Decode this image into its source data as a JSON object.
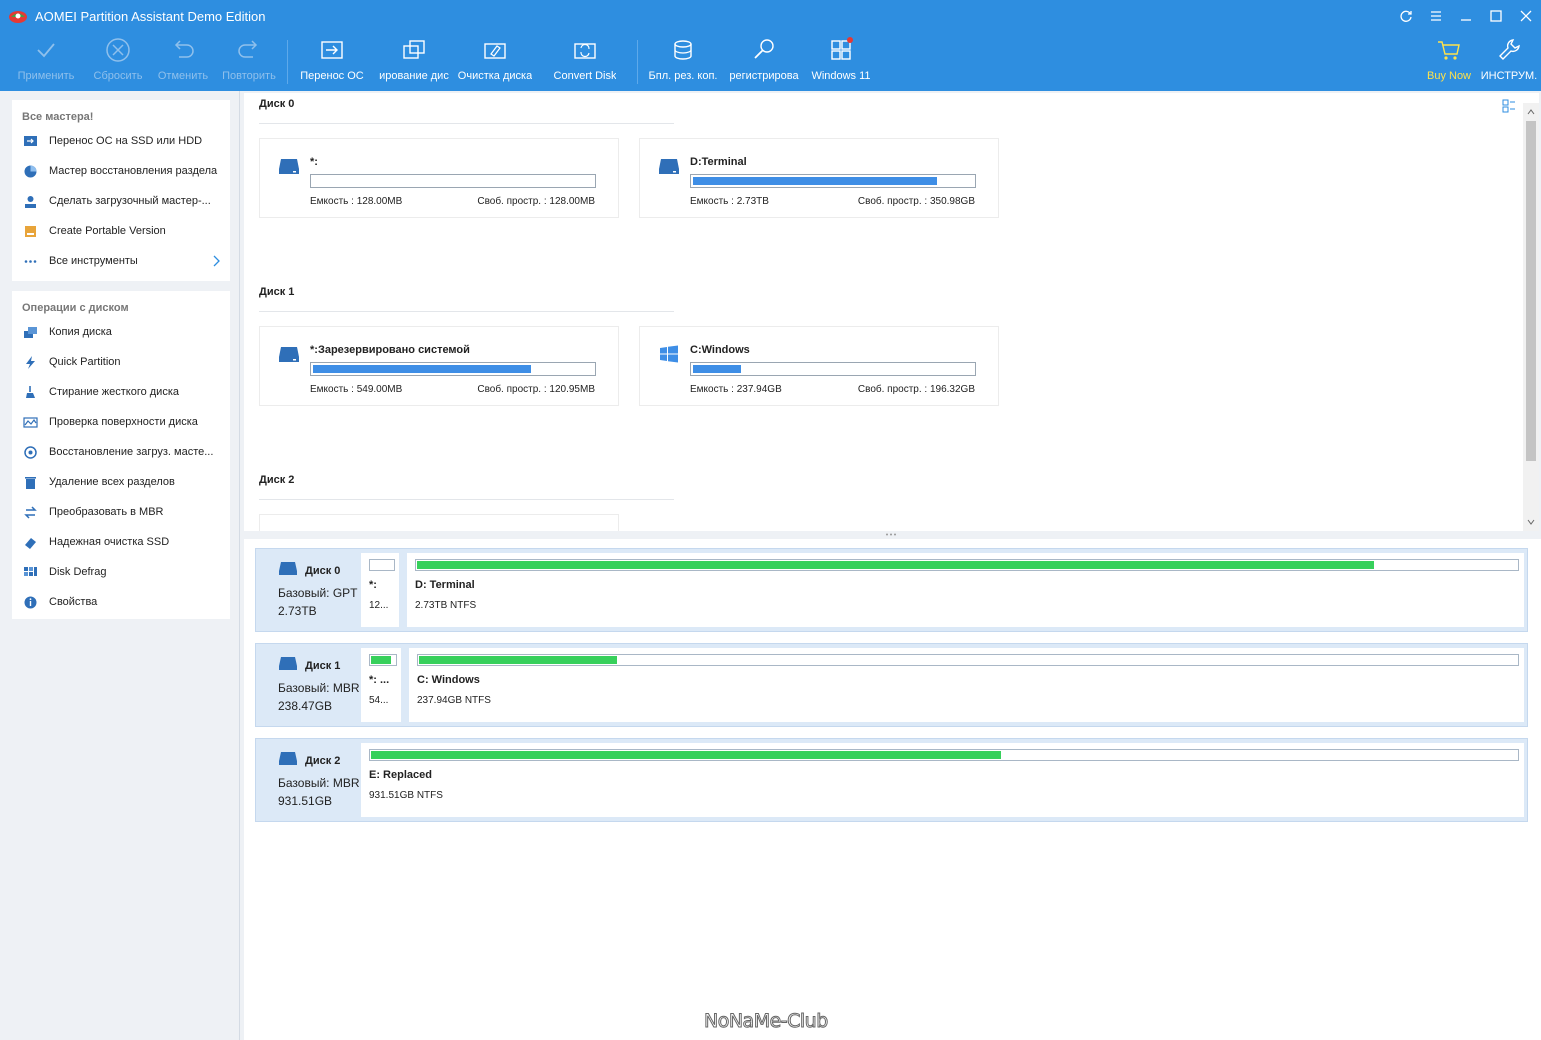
{
  "window": {
    "title": "AOMEI Partition Assistant Demo Edition"
  },
  "toolbar": {
    "apply": "Применить",
    "discard": "Сбросить",
    "undo": "Отменить",
    "redo": "Повторить",
    "migrate_os": "Перенос ОС",
    "clone_disk": "ирование дис",
    "wipe_disk": "Очистка диска",
    "convert_disk": "Convert Disk",
    "backup": "Бпл. рез. коп.",
    "register": "регистрирова",
    "windows11": "Windows 11",
    "buy_now": "Buy Now",
    "tools": "ИНСТРУМ."
  },
  "sidebar": {
    "wizards_title": "Все мастера!",
    "wizards": [
      {
        "label": "Перенос ОС на SSD или HDD"
      },
      {
        "label": "Мастер восстановления раздела"
      },
      {
        "label": "Сделать загрузочный мастер-..."
      },
      {
        "label": "Create Portable Version"
      },
      {
        "label": "Все инструменты"
      }
    ],
    "ops_title": "Операции с диском",
    "ops": [
      {
        "label": "Копия диска"
      },
      {
        "label": "Quick Partition"
      },
      {
        "label": "Стирание жесткого диска"
      },
      {
        "label": "Проверка поверхности диска"
      },
      {
        "label": "Восстановление загруз. масте..."
      },
      {
        "label": "Удаление всех разделов"
      },
      {
        "label": "Преобразовать в MBR"
      },
      {
        "label": "Надежная очистка SSD"
      },
      {
        "label": "Disk Defrag"
      },
      {
        "label": "Свойства"
      }
    ]
  },
  "cards": {
    "disks": [
      {
        "title": "Диск 0",
        "partitions": [
          {
            "name": "*:",
            "used_fraction": 0.0,
            "capacity": "Емкость : 128.00MB",
            "free": "Своб. простр. : 128.00MB",
            "icon": "drive-icon"
          },
          {
            "name": "D:Terminal",
            "used_fraction": 0.87,
            "capacity": "Емкость : 2.73TB",
            "free": "Своб. простр. : 350.98GB",
            "icon": "drive-icon"
          }
        ]
      },
      {
        "title": "Диск 1",
        "partitions": [
          {
            "name": "*:Зарезервировано системой",
            "used_fraction": 0.78,
            "capacity": "Емкость : 549.00MB",
            "free": "Своб. простр. : 120.95MB",
            "icon": "drive-icon"
          },
          {
            "name": "C:Windows",
            "used_fraction": 0.17,
            "capacity": "Емкость : 237.94GB",
            "free": "Своб. простр. : 196.32GB",
            "icon": "windows-icon"
          }
        ]
      },
      {
        "title": "Диск 2",
        "partitions": []
      }
    ]
  },
  "diskmap": {
    "disks": [
      {
        "name": "Диск 0",
        "type": "Базовый: GPT",
        "size": "2.73TB",
        "partitions": [
          {
            "name": "*:",
            "desc": "12...",
            "used_fraction": 0.0
          },
          {
            "name": "D: Terminal",
            "desc": "2.73TB NTFS",
            "used_fraction": 0.87
          }
        ]
      },
      {
        "name": "Диск 1",
        "type": "Базовый: MBR",
        "size": "238.47GB",
        "partitions": [
          {
            "name": "*: ...",
            "desc": "54...",
            "used_fraction": 0.85
          },
          {
            "name": "C: Windows",
            "desc": "237.94GB NTFS",
            "used_fraction": 0.18
          }
        ]
      },
      {
        "name": "Диск 2",
        "type": "Базовый: MBR",
        "size": "931.51GB",
        "partitions": [
          {
            "name": "E: Replaced",
            "desc": "931.51GB NTFS",
            "used_fraction": 0.55
          }
        ]
      }
    ]
  },
  "watermark": "NoNaMe-Club",
  "colors": {
    "titlebar": "#2e8ee0",
    "card_bar": "#3e8ee6",
    "map_bar": "#37d05b",
    "buy_now": "#ffe24a"
  }
}
